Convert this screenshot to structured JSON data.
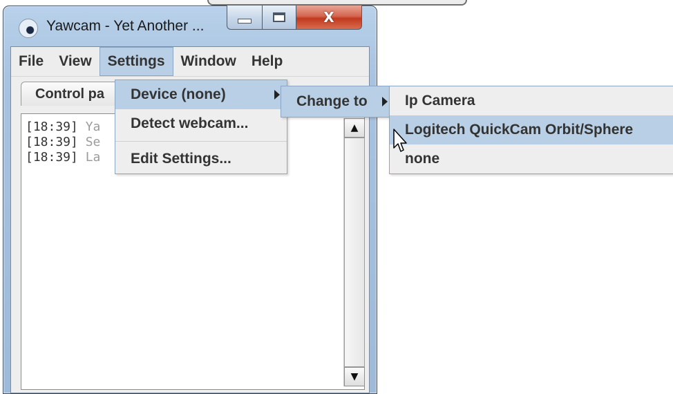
{
  "window": {
    "title": "Yawcam - Yet Another ...",
    "controls": {
      "close_glyph": "X"
    }
  },
  "menubar": {
    "items": [
      {
        "label": "File"
      },
      {
        "label": "View"
      },
      {
        "label": "Settings"
      },
      {
        "label": "Window"
      },
      {
        "label": "Help"
      }
    ],
    "active_item": "Settings"
  },
  "tabs": {
    "control_panel": "Control pa"
  },
  "log": {
    "lines": [
      {
        "time": "[18:39]",
        "text": "Ya"
      },
      {
        "time": "[18:39]",
        "text": "Se"
      },
      {
        "time": "[18:39]",
        "text": "La"
      }
    ]
  },
  "settings_menu": {
    "items": [
      {
        "label": "Device (none)",
        "has_submenu": true,
        "highlighted": true
      },
      {
        "label": "Detect webcam..."
      },
      {
        "label": "Edit Settings..."
      }
    ]
  },
  "device_submenu": {
    "items": [
      {
        "label": "Change to",
        "has_submenu": true,
        "highlighted": true
      }
    ]
  },
  "change_to_submenu": {
    "items": [
      {
        "label": "Ip Camera"
      },
      {
        "label": "Logitech QuickCam Orbit/Sphere",
        "highlighted": true
      },
      {
        "label": "none"
      }
    ]
  },
  "colors": {
    "menu_highlight": "#b8cfe5",
    "menu_border": "#8aa6c4",
    "title_bar": "#a8c3e0",
    "close_button": "#c2391f"
  }
}
